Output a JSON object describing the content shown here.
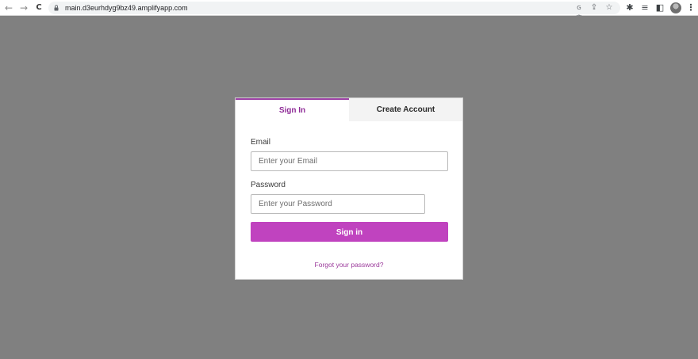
{
  "browser": {
    "url": "main.d3eurhdyg9bz49.amplifyapp.com",
    "back_icon": "←",
    "forward_icon": "→",
    "reload_icon": "C",
    "translate_icon": "G文",
    "share_icon": "⇪",
    "bookmark_icon": "☆",
    "extensions_icon": "✱",
    "media_icon": "≡",
    "side_panel_icon": "◧",
    "menu_icon": "⋮"
  },
  "auth": {
    "tabs": [
      {
        "label": "Sign In"
      },
      {
        "label": "Create Account"
      }
    ],
    "email": {
      "label": "Email",
      "placeholder": "Enter your Email",
      "value": ""
    },
    "password": {
      "label": "Password",
      "placeholder": "Enter your Password",
      "value": ""
    },
    "submit_label": "Sign in",
    "forgot_label": "Forgot your password?"
  },
  "colors": {
    "accent": "#c043bf",
    "accent_text": "#8f2c97",
    "backdrop": "#808080"
  }
}
